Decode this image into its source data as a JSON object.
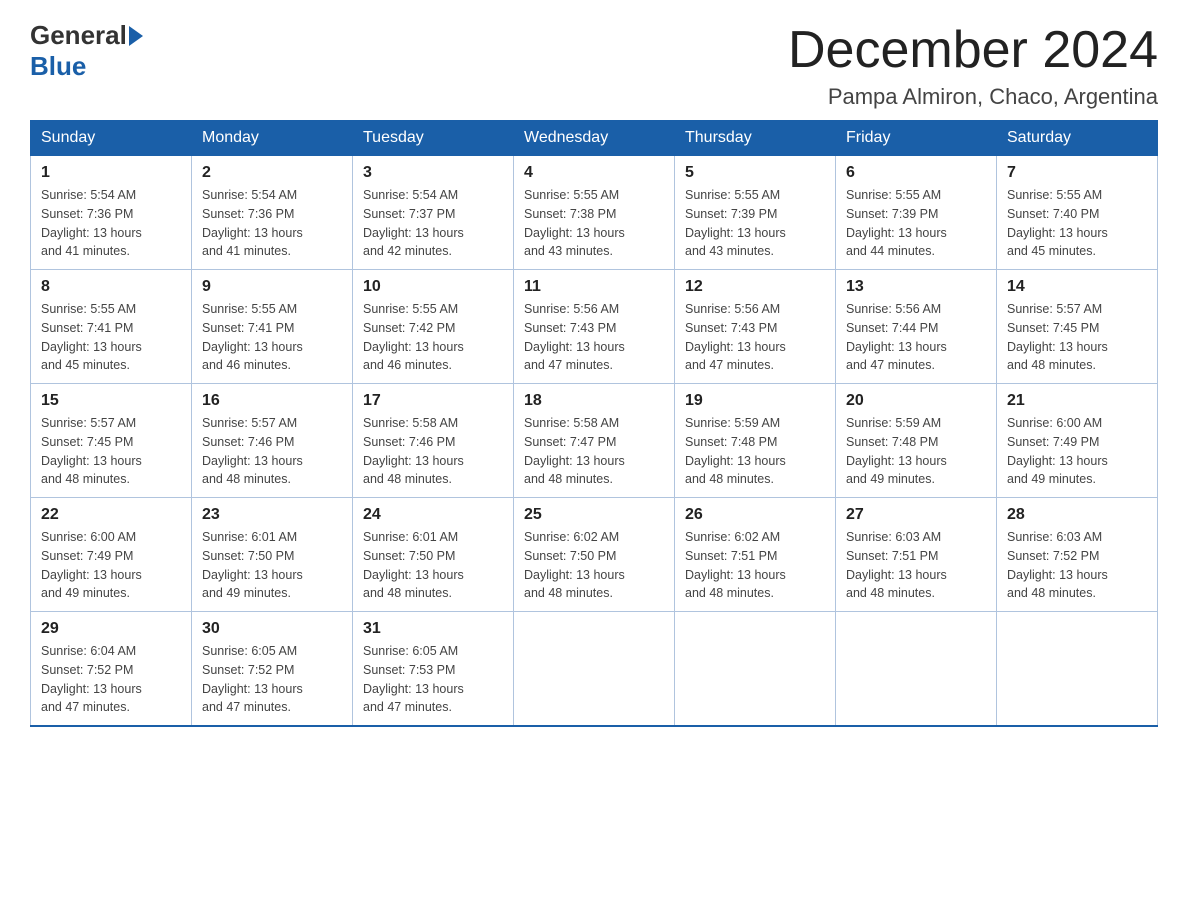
{
  "header": {
    "logo_general": "General",
    "logo_blue": "Blue",
    "month_title": "December 2024",
    "location": "Pampa Almiron, Chaco, Argentina"
  },
  "weekdays": [
    "Sunday",
    "Monday",
    "Tuesday",
    "Wednesday",
    "Thursday",
    "Friday",
    "Saturday"
  ],
  "weeks": [
    [
      {
        "day": 1,
        "sunrise": "5:54 AM",
        "sunset": "7:36 PM",
        "daylight": "13 hours and 41 minutes."
      },
      {
        "day": 2,
        "sunrise": "5:54 AM",
        "sunset": "7:36 PM",
        "daylight": "13 hours and 41 minutes."
      },
      {
        "day": 3,
        "sunrise": "5:54 AM",
        "sunset": "7:37 PM",
        "daylight": "13 hours and 42 minutes."
      },
      {
        "day": 4,
        "sunrise": "5:55 AM",
        "sunset": "7:38 PM",
        "daylight": "13 hours and 43 minutes."
      },
      {
        "day": 5,
        "sunrise": "5:55 AM",
        "sunset": "7:39 PM",
        "daylight": "13 hours and 43 minutes."
      },
      {
        "day": 6,
        "sunrise": "5:55 AM",
        "sunset": "7:39 PM",
        "daylight": "13 hours and 44 minutes."
      },
      {
        "day": 7,
        "sunrise": "5:55 AM",
        "sunset": "7:40 PM",
        "daylight": "13 hours and 45 minutes."
      }
    ],
    [
      {
        "day": 8,
        "sunrise": "5:55 AM",
        "sunset": "7:41 PM",
        "daylight": "13 hours and 45 minutes."
      },
      {
        "day": 9,
        "sunrise": "5:55 AM",
        "sunset": "7:41 PM",
        "daylight": "13 hours and 46 minutes."
      },
      {
        "day": 10,
        "sunrise": "5:55 AM",
        "sunset": "7:42 PM",
        "daylight": "13 hours and 46 minutes."
      },
      {
        "day": 11,
        "sunrise": "5:56 AM",
        "sunset": "7:43 PM",
        "daylight": "13 hours and 47 minutes."
      },
      {
        "day": 12,
        "sunrise": "5:56 AM",
        "sunset": "7:43 PM",
        "daylight": "13 hours and 47 minutes."
      },
      {
        "day": 13,
        "sunrise": "5:56 AM",
        "sunset": "7:44 PM",
        "daylight": "13 hours and 47 minutes."
      },
      {
        "day": 14,
        "sunrise": "5:57 AM",
        "sunset": "7:45 PM",
        "daylight": "13 hours and 48 minutes."
      }
    ],
    [
      {
        "day": 15,
        "sunrise": "5:57 AM",
        "sunset": "7:45 PM",
        "daylight": "13 hours and 48 minutes."
      },
      {
        "day": 16,
        "sunrise": "5:57 AM",
        "sunset": "7:46 PM",
        "daylight": "13 hours and 48 minutes."
      },
      {
        "day": 17,
        "sunrise": "5:58 AM",
        "sunset": "7:46 PM",
        "daylight": "13 hours and 48 minutes."
      },
      {
        "day": 18,
        "sunrise": "5:58 AM",
        "sunset": "7:47 PM",
        "daylight": "13 hours and 48 minutes."
      },
      {
        "day": 19,
        "sunrise": "5:59 AM",
        "sunset": "7:48 PM",
        "daylight": "13 hours and 48 minutes."
      },
      {
        "day": 20,
        "sunrise": "5:59 AM",
        "sunset": "7:48 PM",
        "daylight": "13 hours and 49 minutes."
      },
      {
        "day": 21,
        "sunrise": "6:00 AM",
        "sunset": "7:49 PM",
        "daylight": "13 hours and 49 minutes."
      }
    ],
    [
      {
        "day": 22,
        "sunrise": "6:00 AM",
        "sunset": "7:49 PM",
        "daylight": "13 hours and 49 minutes."
      },
      {
        "day": 23,
        "sunrise": "6:01 AM",
        "sunset": "7:50 PM",
        "daylight": "13 hours and 49 minutes."
      },
      {
        "day": 24,
        "sunrise": "6:01 AM",
        "sunset": "7:50 PM",
        "daylight": "13 hours and 48 minutes."
      },
      {
        "day": 25,
        "sunrise": "6:02 AM",
        "sunset": "7:50 PM",
        "daylight": "13 hours and 48 minutes."
      },
      {
        "day": 26,
        "sunrise": "6:02 AM",
        "sunset": "7:51 PM",
        "daylight": "13 hours and 48 minutes."
      },
      {
        "day": 27,
        "sunrise": "6:03 AM",
        "sunset": "7:51 PM",
        "daylight": "13 hours and 48 minutes."
      },
      {
        "day": 28,
        "sunrise": "6:03 AM",
        "sunset": "7:52 PM",
        "daylight": "13 hours and 48 minutes."
      }
    ],
    [
      {
        "day": 29,
        "sunrise": "6:04 AM",
        "sunset": "7:52 PM",
        "daylight": "13 hours and 47 minutes."
      },
      {
        "day": 30,
        "sunrise": "6:05 AM",
        "sunset": "7:52 PM",
        "daylight": "13 hours and 47 minutes."
      },
      {
        "day": 31,
        "sunrise": "6:05 AM",
        "sunset": "7:53 PM",
        "daylight": "13 hours and 47 minutes."
      },
      null,
      null,
      null,
      null
    ]
  ],
  "labels": {
    "sunrise": "Sunrise:",
    "sunset": "Sunset:",
    "daylight": "Daylight:"
  }
}
